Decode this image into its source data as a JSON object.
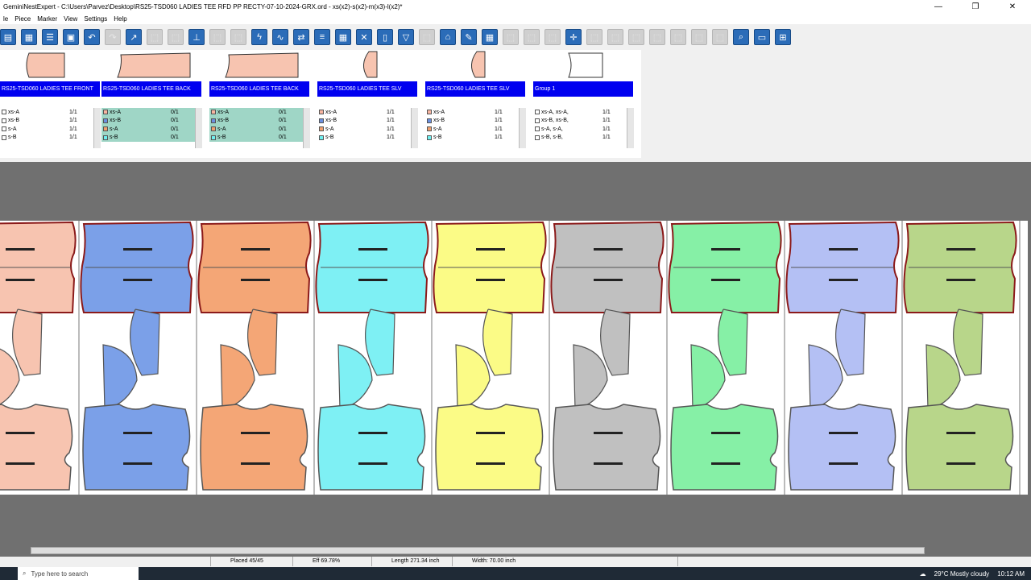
{
  "window": {
    "title": "GeminiNestExpert - C:\\Users\\Parvez\\Desktop\\RS25-TSD060 LADIES TEE RFD PP RECTY-07-10-2024-GRX.ord - xs(x2)-s(x2)-m(x3)-l(x2)*"
  },
  "menu": [
    "le",
    "Piece",
    "Marker",
    "View",
    "Settings",
    "Help"
  ],
  "pieces": [
    {
      "name": "RS25-TSD060 LADIES TEE FRONT",
      "color": "#f7c4b0",
      "rows_bg": "#ffffff",
      "sizes": [
        {
          "label": "xs-A",
          "qty": "1/1"
        },
        {
          "label": "xs-B",
          "qty": "1/1"
        },
        {
          "label": "s-A",
          "qty": "1/1"
        },
        {
          "label": "s-B",
          "qty": "1/1"
        }
      ]
    },
    {
      "name": "RS25-TSD060 LADIES TEE BACK",
      "color": "#f7c4b0",
      "rows_bg": "#9fd6c6",
      "sizes": [
        {
          "label": "xs-A",
          "qty": "0/1"
        },
        {
          "label": "xs-B",
          "qty": "0/1"
        },
        {
          "label": "s-A",
          "qty": "0/1"
        },
        {
          "label": "s-B",
          "qty": "0/1"
        }
      ]
    },
    {
      "name": "RS25-TSD060 LADIES TEE BACK",
      "color": "#f7c4b0",
      "rows_bg": "#9fd6c6",
      "sizes": [
        {
          "label": "xs-A",
          "qty": "0/1"
        },
        {
          "label": "xs-B",
          "qty": "0/1"
        },
        {
          "label": "s-A",
          "qty": "0/1"
        },
        {
          "label": "s-B",
          "qty": "0/1"
        }
      ]
    },
    {
      "name": "RS25-TSD060 LADIES TEE SLV",
      "color": "#f7c4b0",
      "rows_bg": "#ffffff",
      "sizes": [
        {
          "label": "xs-A",
          "qty": "1/1"
        },
        {
          "label": "xs-B",
          "qty": "1/1"
        },
        {
          "label": "s-A",
          "qty": "1/1"
        },
        {
          "label": "s-B",
          "qty": "1/1"
        }
      ]
    },
    {
      "name": "RS25-TSD060 LADIES TEE SLV",
      "color": "#f7c4b0",
      "rows_bg": "#ffffff",
      "sizes": [
        {
          "label": "xs-A",
          "qty": "1/1"
        },
        {
          "label": "xs-B",
          "qty": "1/1"
        },
        {
          "label": "s-A",
          "qty": "1/1"
        },
        {
          "label": "s-B",
          "qty": "1/1"
        }
      ]
    },
    {
      "name": "Group 1",
      "color": "#ffffff",
      "rows_bg": "#ffffff",
      "sizes": [
        {
          "label": "xs-A, xs-A,",
          "qty": "1/1"
        },
        {
          "label": "xs-B, xs-B,",
          "qty": "1/1"
        },
        {
          "label": "s-A, s-A,",
          "qty": "1/1"
        },
        {
          "label": "s-B, s-B,",
          "qty": "1/1"
        }
      ]
    }
  ],
  "size_swatches": [
    "#f7b4a0",
    "#6b8fe0",
    "#f0a070",
    "#70f0f0"
  ],
  "marker_columns": [
    {
      "color": "#f7c4b0"
    },
    {
      "color": "#7ba0e8"
    },
    {
      "color": "#f4a676"
    },
    {
      "color": "#7ef0f4"
    },
    {
      "color": "#fbfb86"
    },
    {
      "color": "#c0c0c0"
    },
    {
      "color": "#86f0a6"
    },
    {
      "color": "#b4c0f4"
    },
    {
      "color": "#b8d68a"
    }
  ],
  "status": {
    "placed": "Placed 45/45",
    "eff": "Eff 69.78%",
    "length": "Length 271.34 inch",
    "width": "Width: 70.00 inch"
  },
  "taskbar": {
    "search_placeholder": "Type here to search",
    "weather": "29°C  Mostly cloudy",
    "time": "10:12 AM"
  }
}
